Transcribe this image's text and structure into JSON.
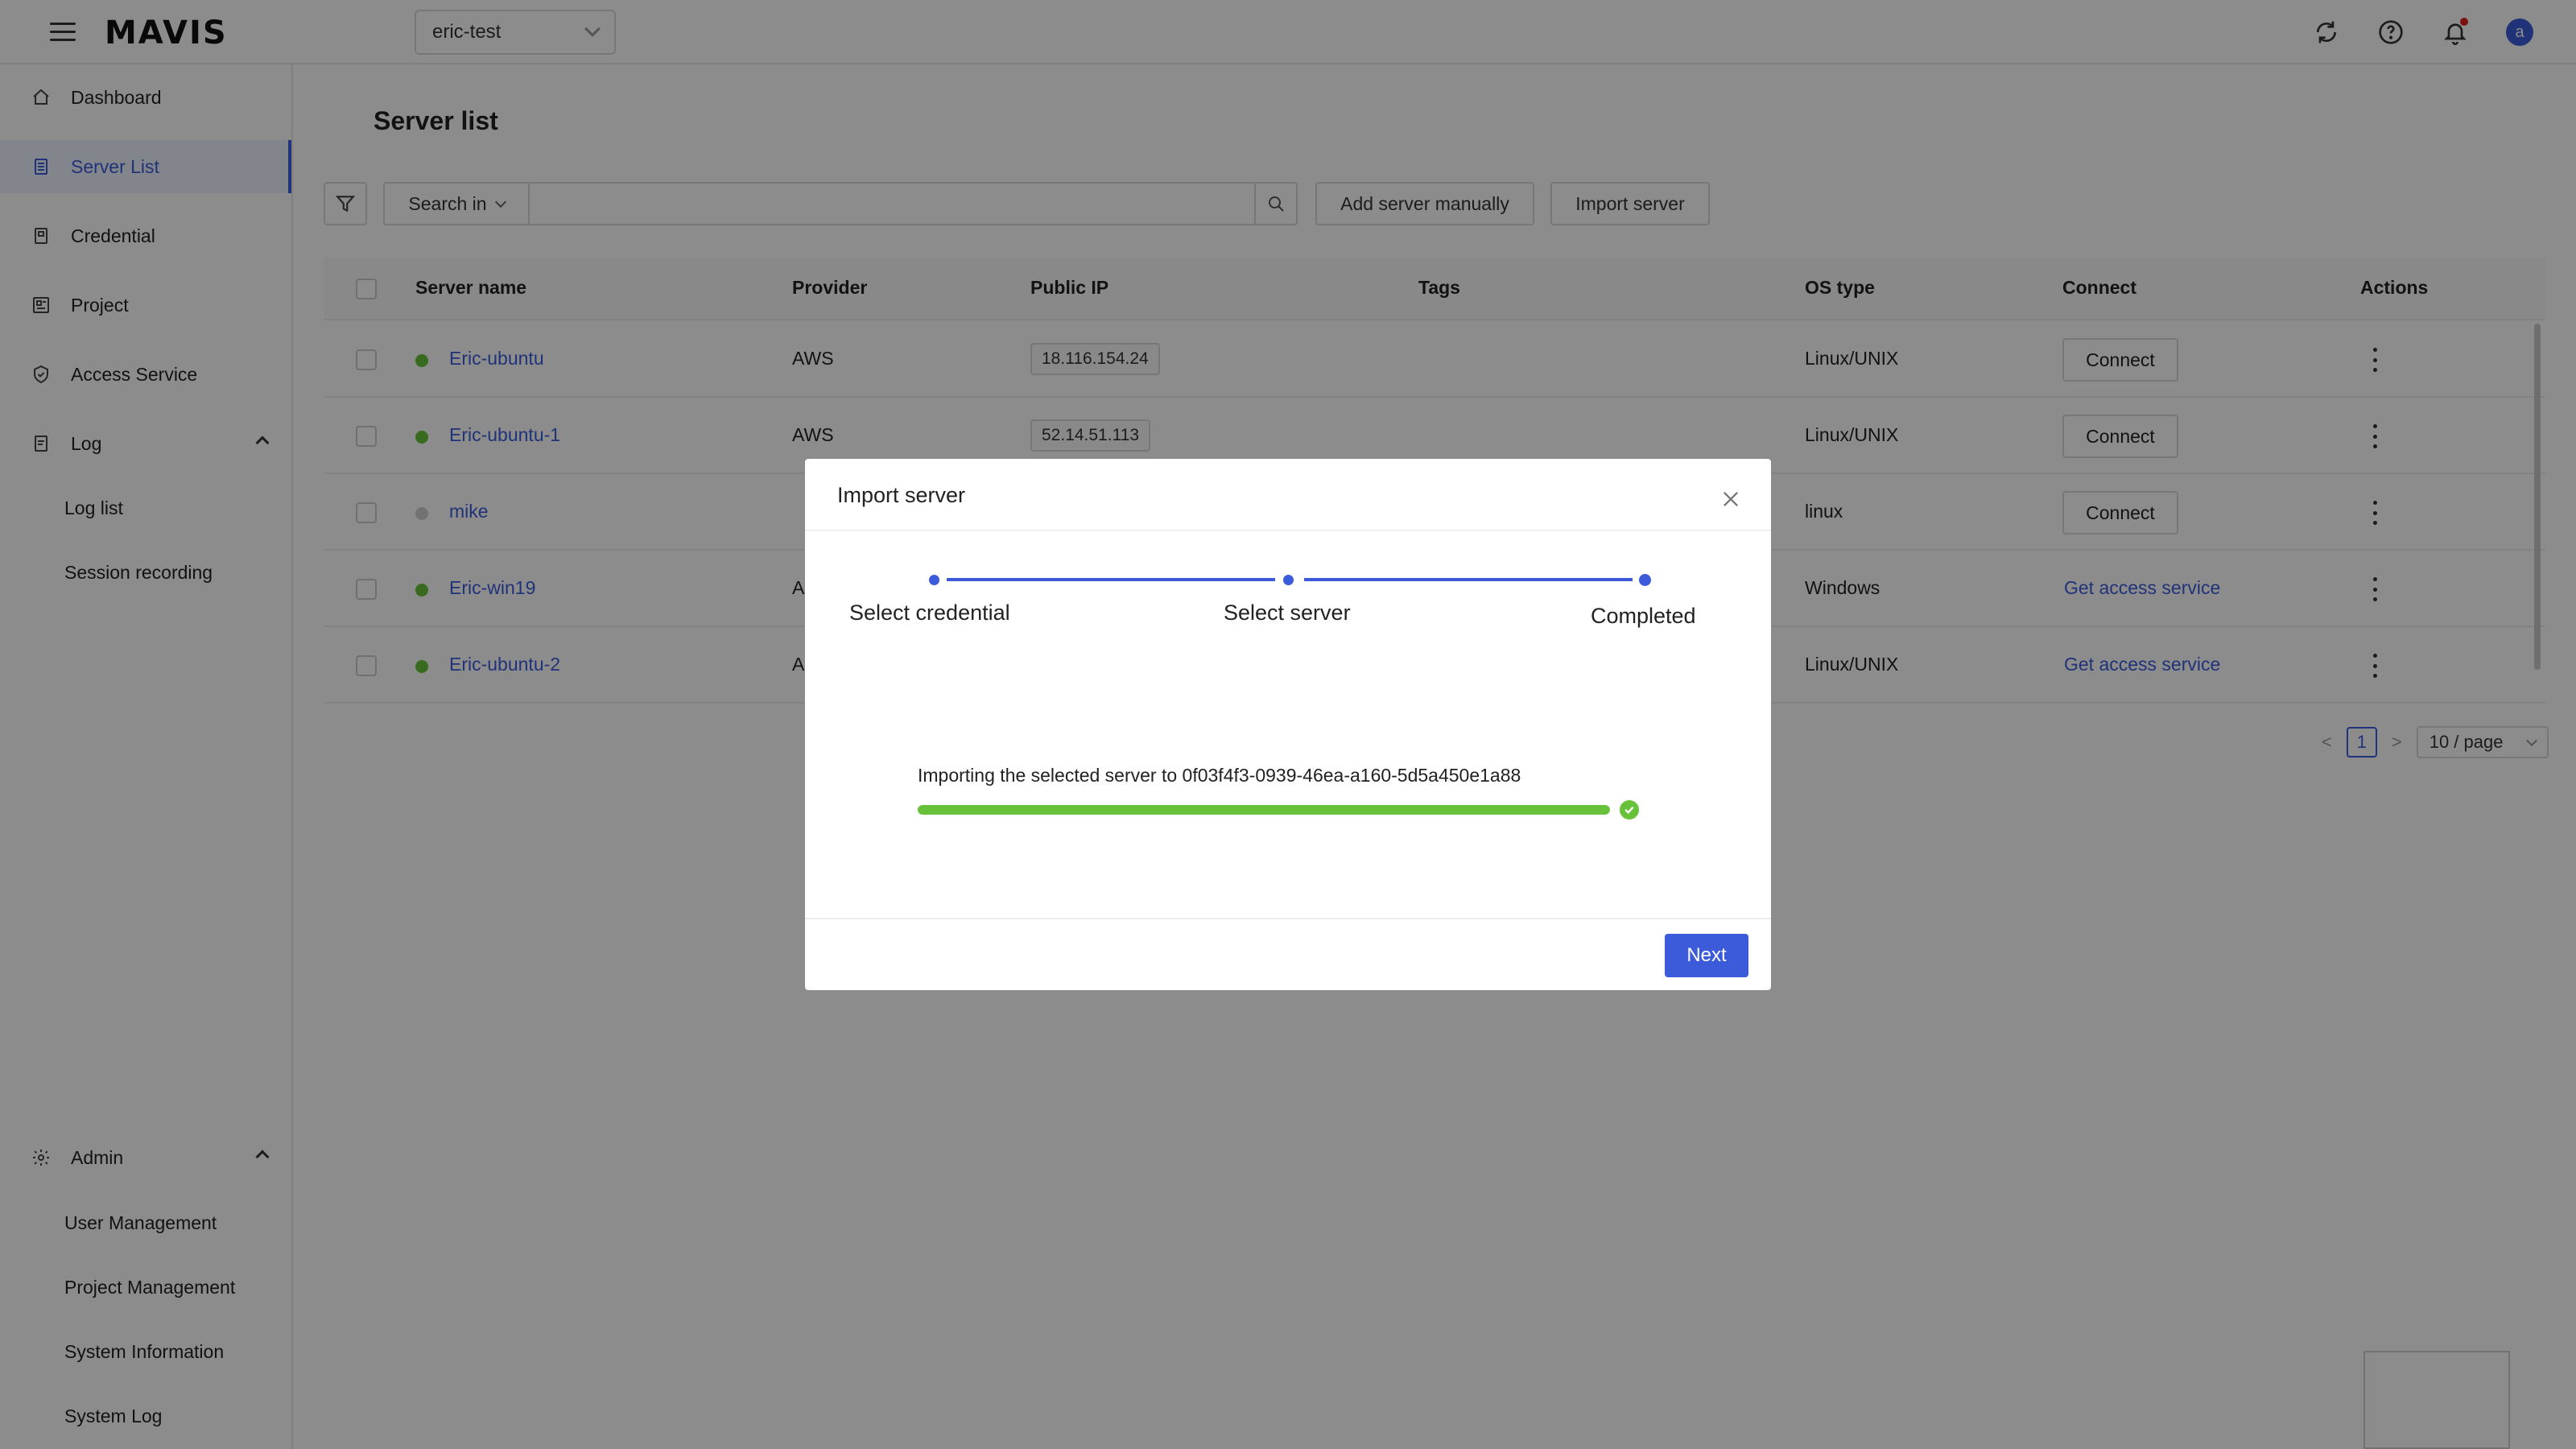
{
  "app": {
    "logo": "MAVIS",
    "project": "eric-test"
  },
  "header": {
    "avatar_initial": "a"
  },
  "sidebar": {
    "items": [
      {
        "label": "Dashboard",
        "icon": "home-icon"
      },
      {
        "label": "Server List",
        "icon": "server-list-icon",
        "active": true
      },
      {
        "label": "Credential",
        "icon": "credential-icon"
      },
      {
        "label": "Project",
        "icon": "project-icon"
      },
      {
        "label": "Access Service",
        "icon": "shield-icon"
      },
      {
        "label": "Log",
        "icon": "log-icon",
        "expanded": true
      }
    ],
    "log_sub": [
      "Log list",
      "Session recording"
    ],
    "admin": {
      "label": "Admin",
      "icon": "gear-icon",
      "expanded": true
    },
    "admin_sub": [
      "User Management",
      "Project Management",
      "System Information",
      "System Log"
    ]
  },
  "main": {
    "title": "Server list",
    "search_in_label": "Search in",
    "search_placeholder": "",
    "add_server_label": "Add server manually",
    "import_server_label": "Import server",
    "columns": [
      "Server name",
      "Provider",
      "Public IP",
      "Tags",
      "OS type",
      "Connect",
      "Actions"
    ],
    "rows": [
      {
        "status": "online",
        "name": "Eric-ubuntu",
        "provider": "AWS",
        "ip": "18.116.154.24",
        "tags": "",
        "os": "Linux/UNIX",
        "connect": "Connect",
        "connect_type": "button"
      },
      {
        "status": "online",
        "name": "Eric-ubuntu-1",
        "provider": "AWS",
        "ip": "52.14.51.113",
        "tags": "",
        "os": "Linux/UNIX",
        "connect": "Connect",
        "connect_type": "button"
      },
      {
        "status": "offline",
        "name": "mike",
        "provider": "",
        "ip": "",
        "tags": "",
        "os": "linux",
        "connect": "Connect",
        "connect_type": "button"
      },
      {
        "status": "online",
        "name": "Eric-win19",
        "provider": "A",
        "ip": "",
        "tags": "",
        "os": "Windows",
        "connect": "Get access service",
        "connect_type": "link"
      },
      {
        "status": "online",
        "name": "Eric-ubuntu-2",
        "provider": "A",
        "ip": "",
        "tags": "",
        "os": "Linux/UNIX",
        "connect": "Get access service",
        "connect_type": "link"
      }
    ],
    "pagination": {
      "prev": "<",
      "current": "1",
      "next": ">",
      "page_size": "10 / page"
    }
  },
  "modal": {
    "title": "Import server",
    "steps": [
      "Select credential",
      "Select server",
      "Completed"
    ],
    "current_step": 3,
    "progress_text": "Importing the selected server to 0f03f4f3-0939-46ea-a160-5d5a450e1a88",
    "progress_percent": 100,
    "next_label": "Next"
  },
  "colors": {
    "accent": "#3b5bdb",
    "status_online": "#67c23a",
    "status_offline": "#d0d0d0",
    "progress": "#67c23a",
    "notification": "#e02020"
  }
}
